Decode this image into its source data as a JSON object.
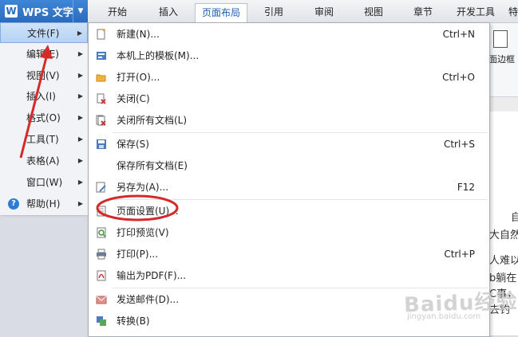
{
  "app": {
    "logo_letter": "W",
    "title": "WPS 文字",
    "dropdown_icon": "chevron-down-icon"
  },
  "tabs": [
    {
      "label": "开始",
      "active": false
    },
    {
      "label": "插入",
      "active": false
    },
    {
      "label": "页面布局",
      "active": true
    },
    {
      "label": "引用",
      "active": false
    },
    {
      "label": "审阅",
      "active": false
    },
    {
      "label": "视图",
      "active": false
    },
    {
      "label": "章节",
      "active": false
    },
    {
      "label": "开发工具",
      "active": false
    },
    {
      "label": "特",
      "active": false
    }
  ],
  "ribbon": {
    "partial_label": "面边框"
  },
  "left_menu": {
    "items": [
      {
        "label": "文件(F)",
        "active": true
      },
      {
        "label": "编辑(E)"
      },
      {
        "label": "视图(V)"
      },
      {
        "label": "插入(I)"
      },
      {
        "label": "格式(O)"
      },
      {
        "label": "工具(T)"
      },
      {
        "label": "表格(A)"
      },
      {
        "label": "窗口(W)"
      },
      {
        "label": "帮助(H)",
        "icon": "help-icon"
      }
    ]
  },
  "file_menu": {
    "items": [
      {
        "label": "新建(N)...",
        "shortcut": "Ctrl+N",
        "icon": "new-document-icon"
      },
      {
        "label": "本机上的模板(M)...",
        "shortcut": "",
        "icon": "template-icon"
      },
      {
        "label": "打开(O)...",
        "shortcut": "Ctrl+O",
        "icon": "open-folder-icon"
      },
      {
        "label": "关闭(C)",
        "shortcut": "",
        "icon": "close-document-icon"
      },
      {
        "label": "关闭所有文档(L)",
        "shortcut": "",
        "icon": "close-all-documents-icon"
      },
      {
        "label": "保存(S)",
        "shortcut": "Ctrl+S",
        "icon": "save-icon"
      },
      {
        "label": "保存所有文档(E)",
        "shortcut": "",
        "icon": ""
      },
      {
        "label": "另存为(A)...",
        "shortcut": "F12",
        "icon": "save-as-icon"
      },
      {
        "label": "页面设置(U)...",
        "shortcut": "",
        "icon": "page-setup-icon"
      },
      {
        "label": "打印预览(V)",
        "shortcut": "",
        "icon": "print-preview-icon"
      },
      {
        "label": "打印(P)...",
        "shortcut": "Ctrl+P",
        "icon": "printer-icon"
      },
      {
        "label": "输出为PDF(F)...",
        "shortcut": "",
        "icon": "pdf-icon"
      },
      {
        "label": "发送邮件(D)...",
        "shortcut": "",
        "icon": "mail-icon"
      },
      {
        "label": "转换(B)",
        "shortcut": "",
        "icon": "convert-icon"
      }
    ]
  },
  "document": {
    "lines": [
      "自",
      "大自然",
      "人难以",
      "b躺在",
      "C事，",
      "去钓"
    ]
  },
  "watermark": {
    "text": "Baidu经验",
    "sub": "jingyan.baidu.com"
  },
  "colors": {
    "accent": "#2b6bbd",
    "annotation": "#d62a2a"
  }
}
